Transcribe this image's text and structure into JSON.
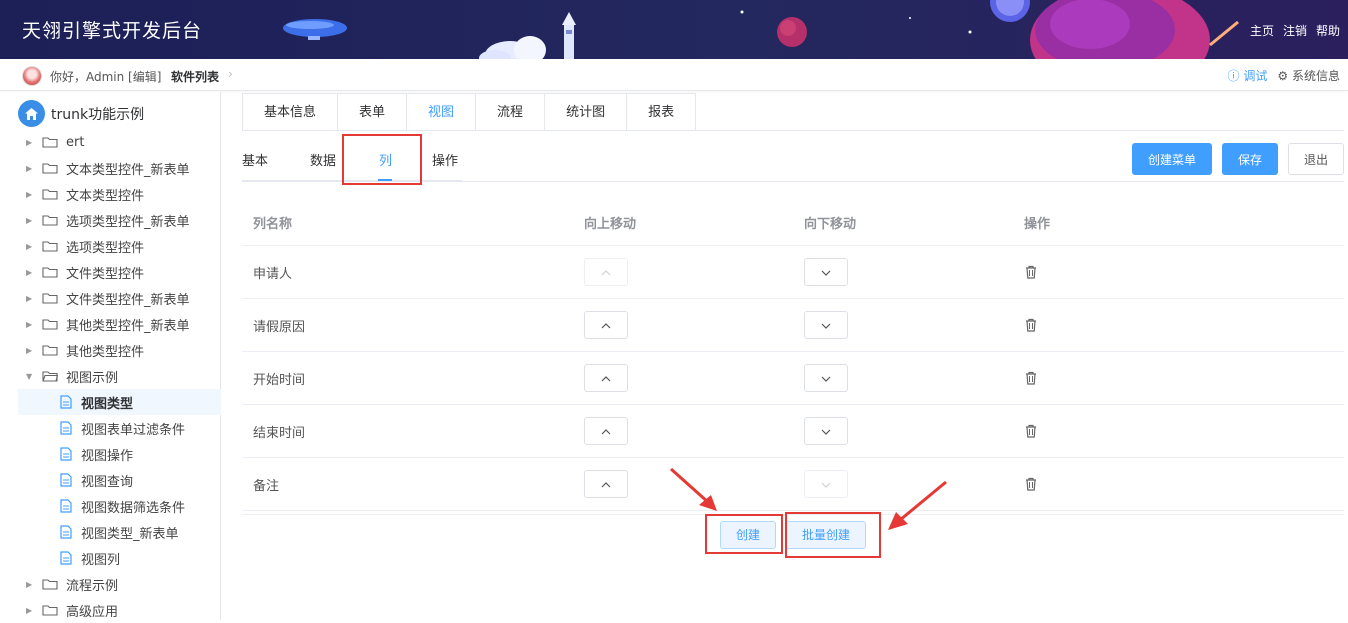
{
  "header": {
    "title": "天翎引擎式开发后台",
    "links": [
      "主页",
      "注销",
      "帮助"
    ]
  },
  "crumb_bar": {
    "greeting": "你好，Admin [编辑]",
    "current": "软件列表",
    "debug": "调试",
    "system_info": "系统信息"
  },
  "sidebar": {
    "root": "trunk功能示例",
    "items": [
      {
        "label": "ert",
        "type": "folder"
      },
      {
        "label": "文本类型控件_新表单",
        "type": "folder"
      },
      {
        "label": "文本类型控件",
        "type": "folder"
      },
      {
        "label": "选项类型控件_新表单",
        "type": "folder"
      },
      {
        "label": "选项类型控件",
        "type": "folder"
      },
      {
        "label": "文件类型控件",
        "type": "folder"
      },
      {
        "label": "文件类型控件_新表单",
        "type": "folder"
      },
      {
        "label": "其他类型控件_新表单",
        "type": "folder"
      },
      {
        "label": "其他类型控件",
        "type": "folder"
      },
      {
        "label": "视图示例",
        "type": "folder-open"
      },
      {
        "label": "视图类型",
        "type": "file",
        "active": true
      },
      {
        "label": "视图表单过滤条件",
        "type": "file"
      },
      {
        "label": "视图操作",
        "type": "file"
      },
      {
        "label": "视图查询",
        "type": "file"
      },
      {
        "label": "视图数据筛选条件",
        "type": "file"
      },
      {
        "label": "视图类型_新表单",
        "type": "file"
      },
      {
        "label": "视图列",
        "type": "file"
      },
      {
        "label": "流程示例",
        "type": "folder"
      },
      {
        "label": "高级应用",
        "type": "folder"
      }
    ]
  },
  "top_tabs": [
    "基本信息",
    "表单",
    "视图",
    "流程",
    "统计图",
    "报表"
  ],
  "top_tab_active": "视图",
  "sub_tabs": [
    "基本",
    "数据",
    "列",
    "操作"
  ],
  "sub_tab_active": "列",
  "actions": {
    "create_menu": "创建菜单",
    "save": "保存",
    "exit": "退出"
  },
  "table": {
    "headers": [
      "列名称",
      "向上移动",
      "向下移动",
      "操作"
    ],
    "rows": [
      "申请人",
      "请假原因",
      "开始时间",
      "结束时间",
      "备注"
    ]
  },
  "footer_buttons": {
    "create": "创建",
    "batch_create": "批量创建"
  },
  "colors": {
    "header_bg": "#1d1f57",
    "primary": "#409eff",
    "annotation_red": "#e53935"
  }
}
